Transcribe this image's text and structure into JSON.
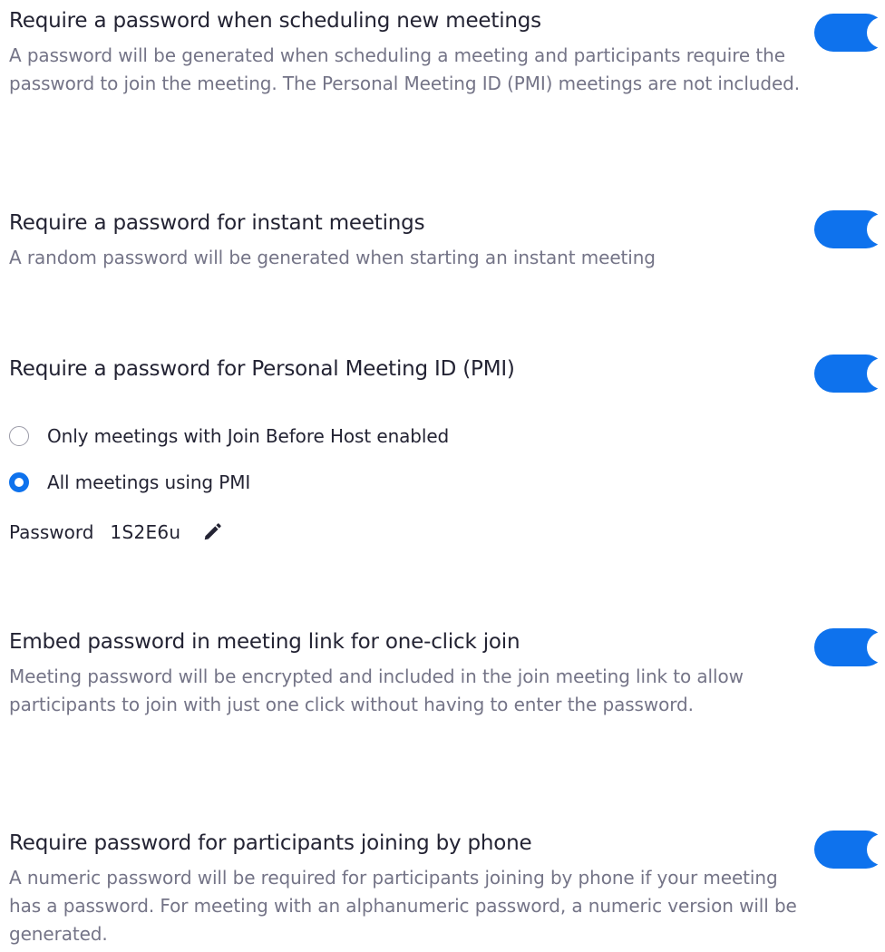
{
  "settings": {
    "scheduling": {
      "title": "Require a password when scheduling new meetings",
      "description": "A password will be generated when scheduling a meeting and participants require the password to join the meeting. The Personal Meeting ID (PMI) meetings are not included.",
      "enabled": true
    },
    "instant": {
      "title": "Require a password for instant meetings",
      "description": "A random password will be generated when starting an instant meeting",
      "enabled": true
    },
    "pmi": {
      "title": "Require a password for Personal Meeting ID (PMI)",
      "enabled": true,
      "options": [
        {
          "label": "Only meetings with Join Before Host enabled",
          "selected": false
        },
        {
          "label": "All meetings using PMI",
          "selected": true
        }
      ],
      "password_label": "Password",
      "password_value": "1S2E6u",
      "edit_icon": "pencil-icon"
    },
    "embed": {
      "title": "Embed password in meeting link for one-click join",
      "description": "Meeting password will be encrypted and included in the join meeting link to allow participants to join with just one click without having to enter the password.",
      "enabled": true
    },
    "phone": {
      "title": "Require password for participants joining by phone",
      "description": "A numeric password will be required for participants joining by phone if your meeting has a password. For meeting with an alphanumeric password, a numeric version will be generated.",
      "enabled": true
    }
  },
  "colors": {
    "accent": "#0e72ed",
    "title_text": "#232333",
    "description_text": "#747487"
  }
}
